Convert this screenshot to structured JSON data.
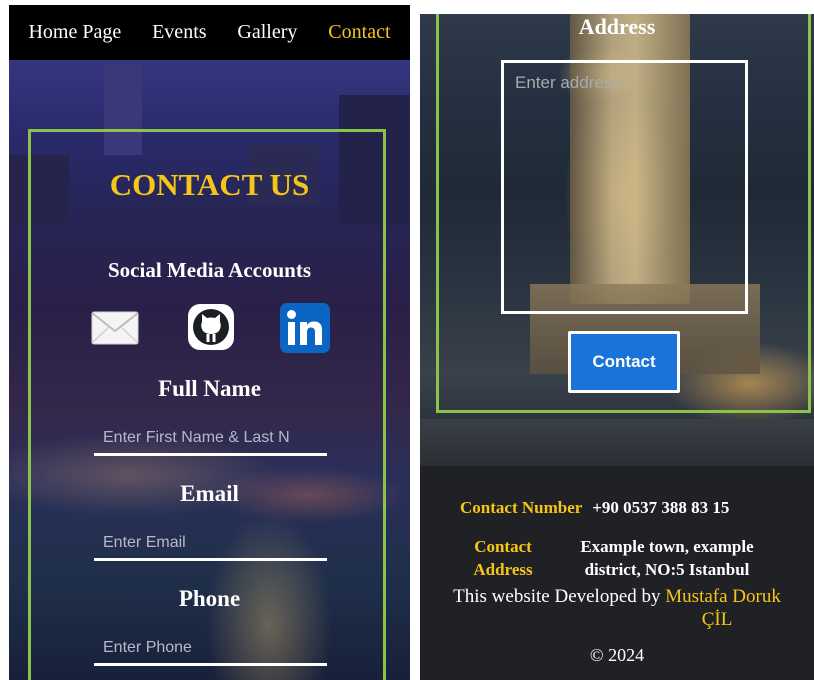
{
  "nav": {
    "items": [
      {
        "label": "Home Page",
        "active": false
      },
      {
        "label": "Events",
        "active": false
      },
      {
        "label": "Gallery",
        "active": false
      },
      {
        "label": "Contact",
        "active": true
      }
    ]
  },
  "contact": {
    "title": "CONTACT US",
    "social_heading": "Social Media Accounts",
    "social_icons": [
      "email-icon",
      "github-icon",
      "linkedin-icon"
    ],
    "full_name_label": "Full Name",
    "full_name_placeholder": "Enter First Name & Last N",
    "email_label": "Email",
    "email_placeholder": "Enter Email",
    "phone_label": "Phone",
    "phone_placeholder": "Enter Phone",
    "address_label": "Address",
    "address_placeholder": "Enter address",
    "submit_label": "Contact"
  },
  "footer": {
    "number_label": "Contact Number",
    "number_value": "+90 0537 388 83 15",
    "address_label_line1": "Contact",
    "address_label_line2": "Address",
    "address_value_line1": "Example town, example",
    "address_value_line2": "district, NO:5 Istanbul",
    "dev_prefix": "This website Developed by",
    "dev_name_line1": "Mustafa Doruk",
    "dev_name_line2": "ÇİL",
    "copyright": "© 2024"
  },
  "colors": {
    "accent_yellow": "#f5c518",
    "border_green": "#8bc34a",
    "button_blue": "#1a73d9",
    "footer_bg": "#202124",
    "nav_bg": "#000000"
  }
}
